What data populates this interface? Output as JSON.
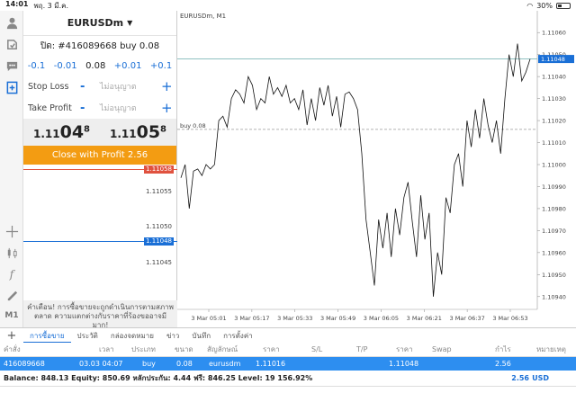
{
  "status": {
    "time": "14:01",
    "date": "พฤ. 3 มี.ค.",
    "battery": "30%",
    "battery_level": 0.3
  },
  "toolbar": {
    "icons": [
      "user-icon",
      "accounts-icon",
      "chat-icon",
      "new-order-icon",
      "crosshair-icon",
      "candles-icon",
      "indicator-icon",
      "objects-icon",
      "timeframe-icon"
    ],
    "timeframe_label": "M1"
  },
  "order_panel": {
    "symbol": "EURUSDm",
    "order_title": "ปิด: #416089668 buy 0.08",
    "volume_steps": [
      "-0.1",
      "-0.01",
      "0.08",
      "+0.01",
      "+0.1"
    ],
    "stop_loss": {
      "label": "Stop Loss",
      "value": "ไม่อนุญาต"
    },
    "take_profit": {
      "label": "Take Profit",
      "value": "ไม่อนุญาต"
    },
    "bid": {
      "prefix": "1.11",
      "big": "04",
      "sup": "8"
    },
    "ask": {
      "prefix": "1.11",
      "big": "05",
      "sup": "8"
    },
    "close_button": "Close with Profit 2.56",
    "mini_levels": {
      "red": "1.11058",
      "p1": "1.11055",
      "p2": "1.11050",
      "blue": "1.11048",
      "p3": "1.11045"
    },
    "warning": "คำเตือน! การซื้อขายจะถูกดำเนินการตามสภาพตลาด ความแตกต่างกับราคาที่ร้องขออาจมีมาก!"
  },
  "chart": {
    "title": "EURUSDm, M1",
    "order_line_label": "buy 0.08",
    "current_price": "1.11048",
    "y_ticks": [
      "1.11060",
      "1.11050",
      "1.11040",
      "1.11030",
      "1.11020",
      "1.11010",
      "1.11000",
      "1.10990",
      "1.10980",
      "1.10970",
      "1.10960",
      "1.10950",
      "1.10940"
    ],
    "x_ticks": [
      "3 Mar 05:01",
      "3 Mar 05:17",
      "3 Mar 05:33",
      "3 Mar 05:49",
      "3 Mar 06:05",
      "3 Mar 06:21",
      "3 Mar 06:37",
      "3 Mar 06:53"
    ]
  },
  "chart_data": {
    "type": "line",
    "title": "EURUSDm, M1",
    "ylim": [
      1.10935,
      1.11065
    ],
    "grid": false,
    "order_level": 1.11016,
    "bid_level": 1.11048,
    "values": [
      1.10994,
      1.11,
      1.1098,
      1.10997,
      1.10998,
      1.10995,
      1.11,
      1.10998,
      1.11,
      1.1102,
      1.11022,
      1.11017,
      1.1103,
      1.11034,
      1.11032,
      1.11028,
      1.1104,
      1.11036,
      1.11025,
      1.1103,
      1.11028,
      1.1104,
      1.11032,
      1.11035,
      1.11031,
      1.11036,
      1.11028,
      1.1103,
      1.11025,
      1.11034,
      1.11018,
      1.1103,
      1.1102,
      1.11035,
      1.11027,
      1.11036,
      1.11022,
      1.11031,
      1.11017,
      1.11032,
      1.11033,
      1.1103,
      1.11025,
      1.11005,
      1.10975,
      1.1096,
      1.10945,
      1.10975,
      1.10962,
      1.10978,
      1.10958,
      1.1098,
      1.10968,
      1.10985,
      1.10992,
      1.10974,
      1.10958,
      1.10986,
      1.10966,
      1.10978,
      1.1094,
      1.1096,
      1.1095,
      1.10985,
      1.10978,
      1.11,
      1.11005,
      1.1099,
      1.1102,
      1.11008,
      1.11025,
      1.11012,
      1.1103,
      1.11018,
      1.1101,
      1.1102,
      1.11005,
      1.1103,
      1.1105,
      1.1104,
      1.11055,
      1.11038,
      1.11042,
      1.11048
    ]
  },
  "tabs": {
    "items": [
      "การซื้อขาย",
      "ประวัติ",
      "กล่องจดหมาย",
      "ข่าว",
      "บันทึก",
      "การตั้งค่า"
    ],
    "active": 0
  },
  "table": {
    "headers": [
      "คำสั่ง",
      "เวลา",
      "ประเภท",
      "ขนาด",
      "สัญลักษณ์",
      "ราคา",
      "S/L",
      "T/P",
      "ราคา",
      "Swap",
      "กำไร",
      "หมายเหตุ"
    ],
    "row": [
      "416089668",
      "03.03 04:07",
      "buy",
      "0.08",
      "eurusdm",
      "1.11016",
      "",
      "",
      "1.11048",
      "",
      "2.56",
      ""
    ]
  },
  "summary": {
    "text": "Balance: 848.13 Equity: 850.69 หลักประกัน: 4.44 ฟรี: 846.25 Level: 19 156.92%",
    "profit": "2.56",
    "currency": "USD"
  }
}
